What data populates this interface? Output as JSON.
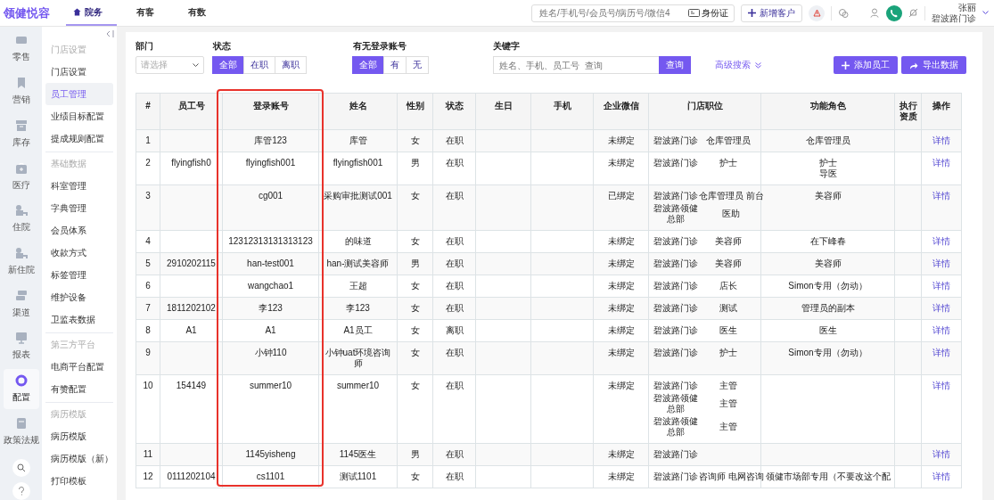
{
  "topbar": {
    "logo": "领健悦容",
    "nav": [
      {
        "label": "院务",
        "selected": true
      },
      {
        "label": "有客",
        "selected": false
      },
      {
        "label": "有数",
        "selected": false
      }
    ],
    "search": {
      "placeholder": "姓名/手机号/会员号/病历号/微信4",
      "id_card_label": "身份证"
    },
    "new_customer_button": "新增客户",
    "user": {
      "name": "张丽",
      "clinic": "碧波路门诊"
    }
  },
  "rail": {
    "items": [
      {
        "label": "零售",
        "selected": false
      },
      {
        "label": "营销",
        "selected": false
      },
      {
        "label": "库存",
        "selected": false
      },
      {
        "label": "医疗",
        "selected": false
      },
      {
        "label": "住院",
        "selected": false
      },
      {
        "label": "新住院",
        "selected": false
      },
      {
        "label": "渠道",
        "selected": false
      },
      {
        "label": "报表",
        "selected": false
      },
      {
        "label": "配置",
        "selected": true
      },
      {
        "label": "政策法规",
        "selected": false
      }
    ]
  },
  "subnav": {
    "items": [
      {
        "kind": "header",
        "label": "门店设置"
      },
      {
        "kind": "item",
        "label": "门店设置",
        "selected": false
      },
      {
        "kind": "item",
        "label": "员工管理",
        "selected": true
      },
      {
        "kind": "item",
        "label": "业绩目标配置",
        "selected": false
      },
      {
        "kind": "item",
        "label": "提成规则配置",
        "selected": false
      },
      {
        "kind": "header",
        "label": "基础数据"
      },
      {
        "kind": "item",
        "label": "科室管理",
        "selected": false
      },
      {
        "kind": "item",
        "label": "字典管理",
        "selected": false
      },
      {
        "kind": "item",
        "label": "会员体系",
        "selected": false
      },
      {
        "kind": "item",
        "label": "收款方式",
        "selected": false
      },
      {
        "kind": "item",
        "label": "标签管理",
        "selected": false
      },
      {
        "kind": "item",
        "label": "维护设备",
        "selected": false
      },
      {
        "kind": "item",
        "label": "卫监表数据",
        "selected": false
      },
      {
        "kind": "header",
        "label": "第三方平台"
      },
      {
        "kind": "item",
        "label": "电商平台配置",
        "selected": false
      },
      {
        "kind": "item",
        "label": "有赞配置",
        "selected": false
      },
      {
        "kind": "header",
        "label": "病历模版"
      },
      {
        "kind": "item",
        "label": "病历模版",
        "selected": false
      },
      {
        "kind": "item",
        "label": "病历模版（新）",
        "selected": false
      },
      {
        "kind": "item",
        "label": "打印模板",
        "selected": false
      }
    ]
  },
  "filters": {
    "department": {
      "label": "部门",
      "placeholder": "请选择"
    },
    "status": {
      "label": "状态",
      "options": [
        {
          "label": "全部",
          "selected": true
        },
        {
          "label": "在职",
          "selected": false
        },
        {
          "label": "离职",
          "selected": false
        }
      ]
    },
    "login_account": {
      "label": "有无登录账号",
      "options": [
        {
          "label": "全部",
          "selected": true
        },
        {
          "label": "有",
          "selected": false
        },
        {
          "label": "无",
          "selected": false
        }
      ]
    },
    "keyword": {
      "label": "关键字",
      "placeholder": "姓名、手机、员工号  查询",
      "button": "查询"
    },
    "advanced_search": "高级搜索",
    "add_button": "添加员工",
    "export_button": "导出数据"
  },
  "table": {
    "columns": [
      {
        "label": "#",
        "highlighted": false
      },
      {
        "label": "员工号",
        "highlighted": false
      },
      {
        "label": "登录账号",
        "highlighted": true
      },
      {
        "label": "姓名",
        "highlighted": false
      },
      {
        "label": "性别",
        "highlighted": false
      },
      {
        "label": "状态",
        "highlighted": false
      },
      {
        "label": "生日",
        "highlighted": false
      },
      {
        "label": "手机",
        "highlighted": false
      },
      {
        "label": "企业微信",
        "highlighted": false
      },
      {
        "label": "门店职位",
        "highlighted": false
      },
      {
        "label": "功能角色",
        "highlighted": false
      },
      {
        "label": "执行资质",
        "highlighted": false
      },
      {
        "label": "操作",
        "highlighted": false
      }
    ],
    "rows": [
      {
        "no": "1",
        "account": "库管123",
        "name": "库管",
        "gender": "女",
        "status": "在职",
        "wecom": "未绑定",
        "positions": [
          {
            "store": "碧波路门诊",
            "role": "仓库管理员"
          }
        ],
        "roles": [
          "仓库管理员"
        ],
        "action": "详情"
      },
      {
        "no": "2",
        "employee_id": "flyingfish0",
        "account": "flyingfish001",
        "name": "flyingfish001",
        "gender": "男",
        "status": "在职",
        "wecom": "未绑定",
        "positions": [
          {
            "store": "碧波路门诊",
            "role": "护士"
          }
        ],
        "roles": [
          "护士",
          "导医"
        ],
        "action": "详情"
      },
      {
        "no": "3",
        "account": "cg001",
        "name": "采购审批测试001",
        "gender": "女",
        "status": "在职",
        "wecom": "已绑定",
        "positions": [
          {
            "store": "碧波路门诊",
            "role": "仓库管理员  前台"
          },
          {
            "store": "碧波路领健总部",
            "role": "医助"
          }
        ],
        "roles": [
          "美容师"
        ],
        "action": "详情"
      },
      {
        "no": "4",
        "account": "12312313131313123",
        "name": "的味道",
        "gender": "女",
        "status": "在职",
        "wecom": "未绑定",
        "positions": [
          {
            "store": "碧波路门诊",
            "role": "美容师"
          }
        ],
        "roles": [
          "在下峰春"
        ],
        "action": "详情"
      },
      {
        "no": "5",
        "employee_id": "2910202115",
        "account": "han-test001",
        "name": "han-测试美容师",
        "gender": "男",
        "status": "在职",
        "wecom": "未绑定",
        "positions": [
          {
            "store": "碧波路门诊",
            "role": "美容师"
          }
        ],
        "roles": [
          "美容师"
        ],
        "action": "详情"
      },
      {
        "no": "6",
        "account": "wangchao1",
        "name": "王超",
        "gender": "女",
        "status": "在职",
        "wecom": "未绑定",
        "positions": [
          {
            "store": "碧波路门诊",
            "role": "店长"
          }
        ],
        "roles": [
          "Simon专用（勿动）"
        ],
        "action": "详情"
      },
      {
        "no": "7",
        "employee_id": "1811202102",
        "account": "李123",
        "name": "李123",
        "gender": "女",
        "status": "在职",
        "wecom": "未绑定",
        "positions": [
          {
            "store": "碧波路门诊",
            "role": "测试"
          }
        ],
        "roles": [
          "管理员的副本"
        ],
        "action": "详情"
      },
      {
        "no": "8",
        "employee_id": "A1",
        "account": "A1",
        "name": "A1员工",
        "gender": "女",
        "status": "离职",
        "wecom": "未绑定",
        "positions": [
          {
            "store": "碧波路门诊",
            "role": "医生"
          }
        ],
        "roles": [
          "医生"
        ],
        "action": "详情"
      },
      {
        "no": "9",
        "account": "小钟110",
        "name": "小钟uat环境咨询师",
        "gender": "女",
        "status": "在职",
        "wecom": "未绑定",
        "positions": [
          {
            "store": "碧波路门诊",
            "role": "护士"
          }
        ],
        "roles": [
          "Simon专用（勿动）"
        ],
        "action": "详情"
      },
      {
        "no": "10",
        "employee_id": "154149",
        "account": "summer10",
        "name": "summer10",
        "gender": "女",
        "status": "在职",
        "wecom": "未绑定",
        "positions": [
          {
            "store": "碧波路门诊",
            "role": "主管"
          },
          {
            "store": "碧波路领健总部",
            "role": "主管"
          },
          {
            "store": "碧波路领健总部",
            "role": "主管"
          }
        ],
        "action": "详情"
      },
      {
        "no": "11",
        "account": "1145yisheng",
        "name": "1145医生",
        "gender": "男",
        "status": "在职",
        "wecom": "未绑定",
        "positions": [
          {
            "store": "碧波路门诊"
          }
        ],
        "action": "详情"
      },
      {
        "no": "12",
        "employee_id": "0111202104",
        "account": "cs1101",
        "name": "测试1101",
        "gender": "女",
        "status": "在职",
        "wecom": "未绑定",
        "positions": [
          {
            "store": "碧波路门诊",
            "role": "咨询师  电网咨询"
          }
        ],
        "roles": [
          "领健市场部专用（不要改这个配"
        ],
        "action": "详情"
      }
    ]
  }
}
